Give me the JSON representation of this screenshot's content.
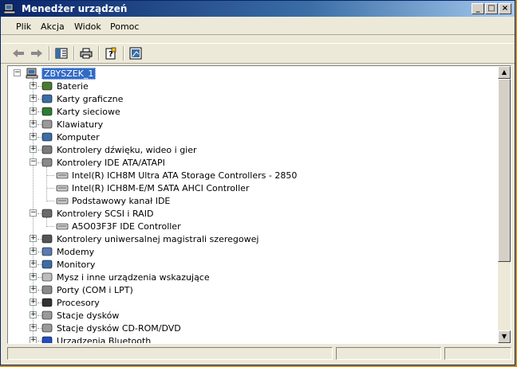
{
  "window": {
    "title": "Menedżer urządzeń",
    "minimize": "_",
    "maximize": "□",
    "close": "×"
  },
  "menu": [
    {
      "label": "Plik"
    },
    {
      "label": "Akcja"
    },
    {
      "label": "Widok"
    },
    {
      "label": "Pomoc"
    }
  ],
  "toolbar": [
    "back-icon",
    "forward-icon",
    "show-hide-tree-icon",
    "print-icon",
    "properties-icon",
    "help-icon"
  ],
  "tree": {
    "root": "ZBYSZEK_1",
    "items": [
      {
        "label": "Baterie",
        "expanded": false,
        "icon": "battery-icon"
      },
      {
        "label": "Karty graficzne",
        "expanded": false,
        "icon": "display-adapter-icon"
      },
      {
        "label": "Karty sieciowe",
        "expanded": false,
        "icon": "network-card-icon"
      },
      {
        "label": "Klawiatury",
        "expanded": false,
        "icon": "keyboard-icon"
      },
      {
        "label": "Komputer",
        "expanded": false,
        "icon": "computer-icon"
      },
      {
        "label": "Kontrolery dźwięku, wideo i gier",
        "expanded": false,
        "icon": "sound-icon"
      },
      {
        "label": "Kontrolery IDE ATA/ATAPI",
        "expanded": true,
        "icon": "ide-icon",
        "children": [
          {
            "label": "Intel(R) ICH8M Ultra ATA Storage Controllers - 2850"
          },
          {
            "label": "Intel(R) ICH8M-E/M SATA AHCI Controller"
          },
          {
            "label": "Podstawowy kanał IDE"
          }
        ]
      },
      {
        "label": "Kontrolery SCSI i RAID",
        "expanded": true,
        "icon": "scsi-icon",
        "children": [
          {
            "label": "A5O03F3F IDE Controller"
          }
        ]
      },
      {
        "label": "Kontrolery uniwersalnej magistrali szeregowej",
        "expanded": false,
        "icon": "usb-icon"
      },
      {
        "label": "Modemy",
        "expanded": false,
        "icon": "modem-icon"
      },
      {
        "label": "Monitory",
        "expanded": false,
        "icon": "monitor-icon"
      },
      {
        "label": "Mysz i inne urządzenia wskazujące",
        "expanded": false,
        "icon": "mouse-icon"
      },
      {
        "label": "Porty (COM i LPT)",
        "expanded": false,
        "icon": "port-icon"
      },
      {
        "label": "Procesory",
        "expanded": false,
        "icon": "cpu-icon"
      },
      {
        "label": "Stacje dysków",
        "expanded": false,
        "icon": "disk-drive-icon"
      },
      {
        "label": "Stacje dysków CD-ROM/DVD",
        "expanded": false,
        "icon": "cdrom-icon"
      },
      {
        "label": "Urządzenia Bluetooth",
        "expanded": false,
        "icon": "bluetooth-icon"
      }
    ]
  },
  "colors": {
    "selection": "#316ac5",
    "titlebar": "#0a246a",
    "face": "#ece9d8"
  }
}
